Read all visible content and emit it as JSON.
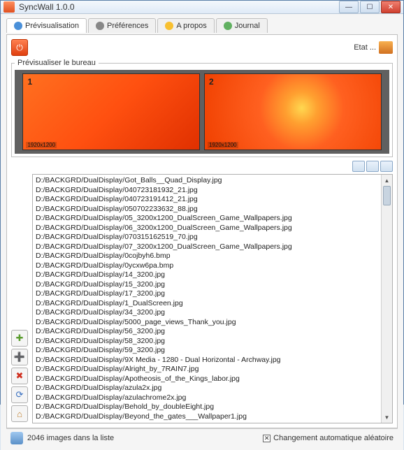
{
  "window": {
    "title": "SyncWall 1.0.0"
  },
  "tabs": [
    {
      "label": "Prévisualisation"
    },
    {
      "label": "Préférences"
    },
    {
      "label": "A propos"
    },
    {
      "label": "Journal"
    }
  ],
  "etat_label": "Etat ...",
  "preview": {
    "legend": "Prévisualiser le bureau",
    "screens": [
      {
        "num": "1",
        "res": "1920x1200"
      },
      {
        "num": "2",
        "res": "1920x1200"
      }
    ]
  },
  "files": [
    "D:/BACKGRD/DualDisplay/Got_Balls__Quad_Display.jpg",
    "D:/BACKGRD/DualDisplay/040723181932_21.jpg",
    "D:/BACKGRD/DualDisplay/040723191412_21.jpg",
    "D:/BACKGRD/DualDisplay/050702233632_88.jpg",
    "D:/BACKGRD/DualDisplay/05_3200x1200_DualScreen_Game_Wallpapers.jpg",
    "D:/BACKGRD/DualDisplay/06_3200x1200_DualScreen_Game_Wallpapers.jpg",
    "D:/BACKGRD/DualDisplay/070315162519_70.jpg",
    "D:/BACKGRD/DualDisplay/07_3200x1200_DualScreen_Game_Wallpapers.jpg",
    "D:/BACKGRD/DualDisplay/0cojbyh6.bmp",
    "D:/BACKGRD/DualDisplay/0ycxw6pa.bmp",
    "D:/BACKGRD/DualDisplay/14_3200.jpg",
    "D:/BACKGRD/DualDisplay/15_3200.jpg",
    "D:/BACKGRD/DualDisplay/17_3200.jpg",
    "D:/BACKGRD/DualDisplay/1_DualScreen.jpg",
    "D:/BACKGRD/DualDisplay/34_3200.jpg",
    "D:/BACKGRD/DualDisplay/5000_page_views_Thank_you.jpg",
    "D:/BACKGRD/DualDisplay/56_3200.jpg",
    "D:/BACKGRD/DualDisplay/58_3200.jpg",
    "D:/BACKGRD/DualDisplay/59_3200.jpg",
    "D:/BACKGRD/DualDisplay/9X Media - 1280 - Dual Horizontal - Archway.jpg",
    "D:/BACKGRD/DualDisplay/Alright_by_7RAIN7.jpg",
    "D:/BACKGRD/DualDisplay/Apotheosis_of_the_Kings_labor.jpg",
    "D:/BACKGRD/DualDisplay/azula2x.jpg",
    "D:/BACKGRD/DualDisplay/azulachrome2x.jpg",
    "D:/BACKGRD/DualDisplay/Behold_by_doubleEight.jpg",
    "D:/BACKGRD/DualDisplay/Beyond_the_gates___Wallpaper1.jpg"
  ],
  "status": {
    "count_text": "2046 images dans la liste",
    "auto_label": "Changement automatique aléatoire",
    "auto_checked": true
  }
}
